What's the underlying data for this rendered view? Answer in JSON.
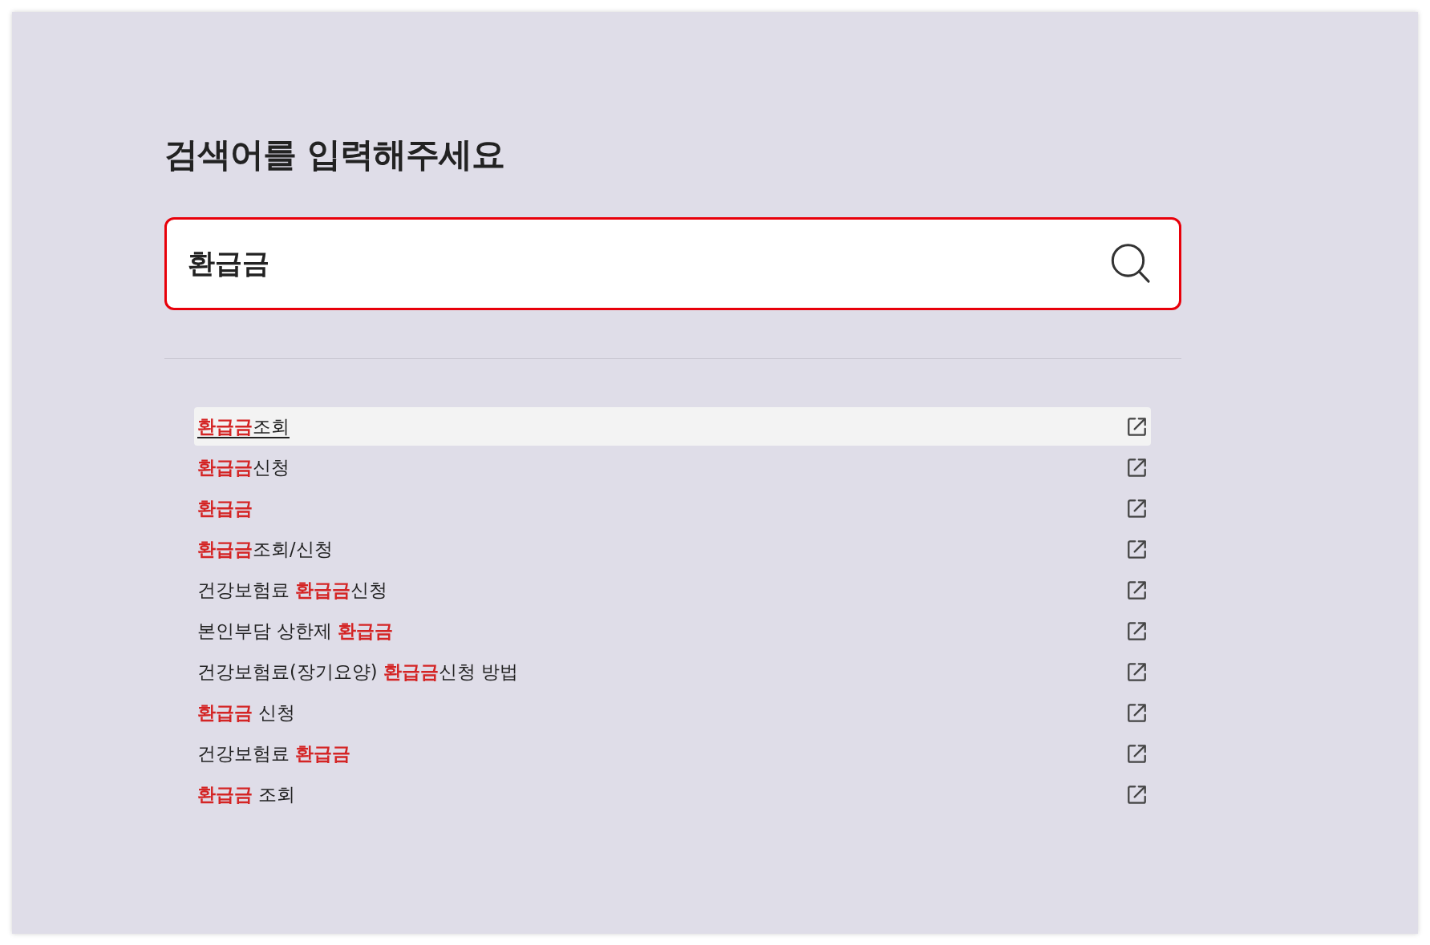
{
  "heading": "검색어를 입력해주세요",
  "search": {
    "value": "환급금"
  },
  "suggestions": [
    {
      "text": "**환급금**조회",
      "selected": true
    },
    {
      "text": "**환급금**신청",
      "selected": false
    },
    {
      "text": "**환급금**",
      "selected": false
    },
    {
      "text": "**환급금**조회/신청",
      "selected": false
    },
    {
      "text": "건강보험료 **환급금**신청",
      "selected": false
    },
    {
      "text": "본인부담 상한제 **환급금**",
      "selected": false
    },
    {
      "text": "건강보험료(장기요양) **환급금**신청 방법",
      "selected": false
    },
    {
      "text": "**환급금** 신청",
      "selected": false
    },
    {
      "text": "건강보험료 **환급금**",
      "selected": false
    },
    {
      "text": "**환급금** 조회",
      "selected": false
    }
  ]
}
